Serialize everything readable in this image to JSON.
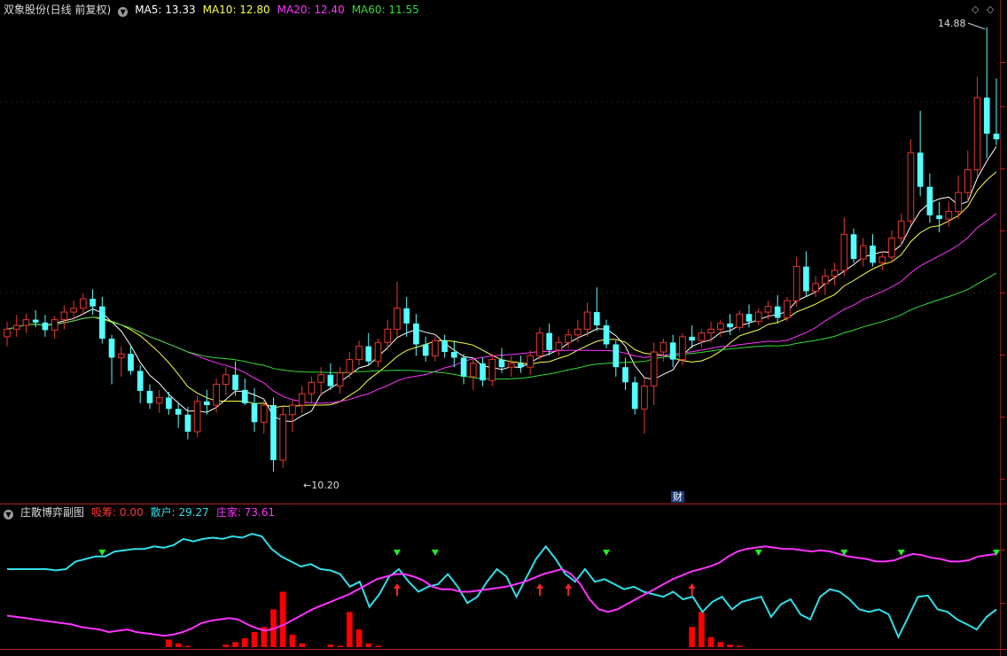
{
  "header": {
    "title": "双象股份(日线 前复权)",
    "ma5": "MA5: 13.33",
    "ma10": "MA10: 12.80",
    "ma20": "MA20: 12.40",
    "ma60": "MA60: 11.55"
  },
  "sub_header": {
    "title": "庄散博弈副图",
    "xichou": "吸筹: 0.00",
    "sanhu": "散户: 29.27",
    "zhuangjia": "庄家: 73.61"
  },
  "annotations": {
    "high_label": "14.88",
    "low_label": "10.20",
    "cai_label": "财"
  },
  "colors": {
    "up": "#e8372c",
    "down": "#54ffff",
    "ma5": "#ffffff",
    "ma10": "#ffff4d",
    "ma20": "#ff33ff",
    "ma60": "#33dd33",
    "retail": "#33dde8",
    "dealer": "#ff33ff",
    "accumulate": "#ff0000",
    "green_marker": "#22ee22",
    "red_marker": "#ff2222"
  },
  "chart_data": [
    {
      "type": "candlestick",
      "title": "双象股份(日线 前复权)",
      "y_marks": {
        "high": 14.88,
        "low": 10.2
      },
      "series_names": [
        "MA5",
        "MA10",
        "MA20",
        "MA60"
      ],
      "ohlc": [
        [
          11.62,
          11.78,
          11.52,
          11.7
        ],
        [
          11.7,
          11.85,
          11.62,
          11.74
        ],
        [
          11.74,
          11.86,
          11.66,
          11.8
        ],
        [
          11.8,
          11.9,
          11.72,
          11.77
        ],
        [
          11.77,
          11.85,
          11.62,
          11.69
        ],
        [
          11.69,
          11.84,
          11.6,
          11.8
        ],
        [
          11.8,
          11.95,
          11.7,
          11.88
        ],
        [
          11.88,
          12.0,
          11.78,
          11.92
        ],
        [
          11.92,
          12.08,
          11.85,
          12.02
        ],
        [
          12.02,
          12.12,
          11.85,
          11.94
        ],
        [
          11.94,
          12.04,
          11.55,
          11.6
        ],
        [
          11.6,
          11.64,
          11.12,
          11.4
        ],
        [
          11.4,
          11.52,
          11.2,
          11.44
        ],
        [
          11.44,
          11.52,
          11.22,
          11.26
        ],
        [
          11.26,
          11.32,
          10.92,
          11.05
        ],
        [
          11.05,
          11.12,
          10.86,
          10.92
        ],
        [
          10.92,
          11.06,
          10.82,
          10.98
        ],
        [
          10.98,
          11.04,
          10.8,
          10.86
        ],
        [
          10.86,
          10.92,
          10.66,
          10.8
        ],
        [
          10.8,
          10.88,
          10.54,
          10.62
        ],
        [
          10.62,
          11.0,
          10.56,
          10.94
        ],
        [
          10.94,
          11.06,
          10.8,
          10.9
        ],
        [
          10.9,
          11.18,
          10.82,
          11.12
        ],
        [
          11.12,
          11.3,
          11.0,
          11.22
        ],
        [
          11.22,
          11.36,
          11.0,
          11.06
        ],
        [
          11.06,
          11.18,
          10.9,
          10.92
        ],
        [
          10.92,
          11.08,
          10.62,
          10.72
        ],
        [
          10.72,
          10.95,
          10.6,
          10.9
        ],
        [
          10.9,
          10.98,
          10.2,
          10.32
        ],
        [
          10.32,
          10.88,
          10.24,
          10.8
        ],
        [
          10.8,
          10.95,
          10.62,
          10.9
        ],
        [
          10.9,
          11.1,
          10.82,
          11.02
        ],
        [
          11.02,
          11.2,
          10.92,
          11.14
        ],
        [
          11.14,
          11.3,
          11.0,
          11.22
        ],
        [
          11.22,
          11.34,
          11.06,
          11.1
        ],
        [
          11.1,
          11.3,
          11.02,
          11.24
        ],
        [
          11.24,
          11.46,
          11.18,
          11.38
        ],
        [
          11.38,
          11.58,
          11.32,
          11.52
        ],
        [
          11.52,
          11.66,
          11.32,
          11.36
        ],
        [
          11.36,
          11.6,
          11.3,
          11.56
        ],
        [
          11.56,
          11.8,
          11.48,
          11.7
        ],
        [
          11.7,
          12.2,
          11.62,
          11.92
        ],
        [
          11.92,
          12.04,
          11.62,
          11.76
        ],
        [
          11.76,
          11.86,
          11.42,
          11.54
        ],
        [
          11.54,
          11.62,
          11.36,
          11.42
        ],
        [
          11.42,
          11.62,
          11.36,
          11.58
        ],
        [
          11.58,
          11.64,
          11.4,
          11.46
        ],
        [
          11.46,
          11.58,
          11.3,
          11.4
        ],
        [
          11.4,
          11.44,
          11.12,
          11.2
        ],
        [
          11.2,
          11.38,
          11.06,
          11.34
        ],
        [
          11.34,
          11.4,
          11.1,
          11.16
        ],
        [
          11.16,
          11.44,
          11.1,
          11.38
        ],
        [
          11.38,
          11.5,
          11.24,
          11.3
        ],
        [
          11.3,
          11.42,
          11.2,
          11.34
        ],
        [
          11.34,
          11.42,
          11.24,
          11.3
        ],
        [
          11.3,
          11.48,
          11.22,
          11.42
        ],
        [
          11.42,
          11.72,
          11.38,
          11.66
        ],
        [
          11.66,
          11.76,
          11.42,
          11.48
        ],
        [
          11.48,
          11.62,
          11.42,
          11.56
        ],
        [
          11.56,
          11.7,
          11.5,
          11.64
        ],
        [
          11.64,
          11.8,
          11.56,
          11.7
        ],
        [
          11.7,
          11.98,
          11.62,
          11.88
        ],
        [
          11.88,
          12.14,
          11.68,
          11.74
        ],
        [
          11.74,
          11.8,
          11.5,
          11.54
        ],
        [
          11.54,
          11.58,
          11.2,
          11.3
        ],
        [
          11.3,
          11.4,
          11.06,
          11.14
        ],
        [
          11.14,
          11.2,
          10.8,
          10.86
        ],
        [
          10.86,
          11.18,
          10.6,
          11.1
        ],
        [
          11.1,
          11.56,
          10.9,
          11.46
        ],
        [
          11.46,
          11.6,
          11.36,
          11.56
        ],
        [
          11.56,
          11.64,
          11.3,
          11.38
        ],
        [
          11.38,
          11.66,
          11.32,
          11.62
        ],
        [
          11.62,
          11.74,
          11.5,
          11.58
        ],
        [
          11.58,
          11.7,
          11.5,
          11.66
        ],
        [
          11.66,
          11.78,
          11.56,
          11.7
        ],
        [
          11.7,
          11.8,
          11.62,
          11.76
        ],
        [
          11.76,
          11.86,
          11.64,
          11.72
        ],
        [
          11.72,
          11.9,
          11.68,
          11.86
        ],
        [
          11.86,
          11.96,
          11.72,
          11.78
        ],
        [
          11.78,
          11.92,
          11.74,
          11.88
        ],
        [
          11.88,
          12.0,
          11.8,
          11.94
        ],
        [
          11.94,
          12.06,
          11.76,
          11.82
        ],
        [
          11.82,
          12.04,
          11.78,
          12.0
        ],
        [
          12.0,
          12.46,
          11.94,
          12.36
        ],
        [
          12.36,
          12.52,
          12.04,
          12.1
        ],
        [
          12.1,
          12.26,
          12.04,
          12.18
        ],
        [
          12.18,
          12.34,
          12.06,
          12.26
        ],
        [
          12.26,
          12.4,
          12.16,
          12.32
        ],
        [
          12.32,
          12.88,
          12.26,
          12.7
        ],
        [
          12.7,
          12.76,
          12.4,
          12.44
        ],
        [
          12.44,
          12.66,
          12.36,
          12.58
        ],
        [
          12.58,
          12.7,
          12.36,
          12.4
        ],
        [
          12.4,
          12.52,
          12.32,
          12.46
        ],
        [
          12.46,
          12.74,
          12.4,
          12.66
        ],
        [
          12.66,
          12.92,
          12.58,
          12.84
        ],
        [
          12.84,
          13.7,
          12.8,
          13.56
        ],
        [
          13.56,
          14.0,
          13.1,
          13.2
        ],
        [
          13.2,
          13.34,
          12.82,
          12.9
        ],
        [
          12.9,
          13.04,
          12.72,
          12.86
        ],
        [
          12.86,
          13.04,
          12.78,
          12.94
        ],
        [
          12.94,
          13.32,
          12.86,
          13.14
        ],
        [
          13.14,
          13.58,
          13.04,
          13.38
        ],
        [
          13.38,
          14.36,
          13.3,
          14.14
        ],
        [
          14.14,
          14.88,
          13.5,
          13.76
        ],
        [
          13.76,
          14.34,
          13.64,
          13.7
        ]
      ]
    },
    {
      "type": "line",
      "title": "庄散博弈副图",
      "series": [
        {
          "name": "散户",
          "last": 29.27,
          "values": [
            62,
            62,
            62,
            62,
            62,
            61,
            62,
            68,
            70,
            72,
            72,
            76,
            77,
            78,
            78,
            80,
            79,
            81,
            86,
            84,
            86,
            87,
            86,
            88,
            87,
            90,
            88,
            78,
            72,
            68,
            64,
            66,
            62,
            61,
            58,
            48,
            52,
            32,
            42,
            56,
            62,
            52,
            44,
            48,
            50,
            58,
            48,
            35,
            40,
            52,
            62,
            56,
            40,
            55,
            70,
            80,
            70,
            58,
            52,
            62,
            52,
            54,
            50,
            46,
            48,
            44,
            42,
            40,
            44,
            38,
            40,
            28,
            36,
            40,
            30,
            36,
            38,
            40,
            24,
            34,
            38,
            26,
            22,
            40,
            46,
            44,
            38,
            30,
            28,
            30,
            26,
            8,
            24,
            40,
            41,
            30,
            28,
            22,
            18,
            14,
            24,
            30
          ]
        },
        {
          "name": "庄家",
          "last": 73.61,
          "values": [
            25,
            24,
            23,
            22,
            21,
            20,
            19,
            18,
            16,
            15,
            14,
            12,
            13,
            14,
            12,
            11,
            10,
            9,
            10,
            12,
            15,
            19,
            21,
            22,
            23,
            22,
            18,
            15,
            13,
            15,
            18,
            22,
            26,
            30,
            33,
            36,
            39,
            42,
            46,
            50,
            54,
            56,
            58,
            58,
            56,
            53,
            48,
            46,
            46,
            44,
            44,
            45,
            46,
            47,
            48,
            50,
            52,
            55,
            58,
            60,
            62,
            58,
            50,
            38,
            30,
            28,
            30,
            34,
            38,
            42,
            46,
            50,
            54,
            57,
            60,
            62,
            64,
            67,
            72,
            76,
            78,
            79,
            80,
            79,
            78,
            78,
            77,
            76,
            77,
            76,
            74,
            72,
            71,
            70,
            68,
            68,
            69,
            72,
            74,
            73,
            71,
            70,
            68,
            68,
            69,
            72,
            73,
            74
          ]
        },
        {
          "name": "吸筹",
          "last": 0.0,
          "bars": [
            {
              "i": 17,
              "v": 6
            },
            {
              "i": 18,
              "v": 3
            },
            {
              "i": 19,
              "v": 1
            },
            {
              "i": 23,
              "v": 2
            },
            {
              "i": 24,
              "v": 4
            },
            {
              "i": 25,
              "v": 7
            },
            {
              "i": 26,
              "v": 12
            },
            {
              "i": 27,
              "v": 16
            },
            {
              "i": 28,
              "v": 30
            },
            {
              "i": 29,
              "v": 44
            },
            {
              "i": 30,
              "v": 10
            },
            {
              "i": 31,
              "v": 3
            },
            {
              "i": 34,
              "v": 2
            },
            {
              "i": 35,
              "v": 1
            },
            {
              "i": 36,
              "v": 28
            },
            {
              "i": 37,
              "v": 14
            },
            {
              "i": 38,
              "v": 3
            },
            {
              "i": 39,
              "v": 1
            },
            {
              "i": 72,
              "v": 16
            },
            {
              "i": 73,
              "v": 28
            },
            {
              "i": 74,
              "v": 8
            },
            {
              "i": 75,
              "v": 4
            },
            {
              "i": 76,
              "v": 2
            },
            {
              "i": 77,
              "v": 1
            }
          ]
        }
      ],
      "green_markers": [
        10,
        41,
        45,
        63,
        79,
        88,
        94,
        104
      ],
      "red_markers": [
        41,
        56,
        59,
        72
      ]
    }
  ]
}
